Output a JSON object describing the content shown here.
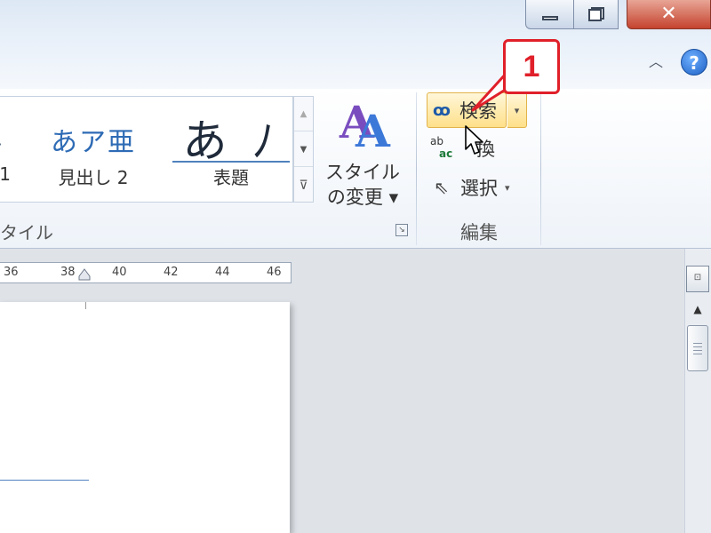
{
  "styles_group": {
    "items": [
      {
        "sample": "亜",
        "label": "1"
      },
      {
        "sample": "あア亜",
        "label": "見出し 2"
      },
      {
        "sample": "あ ﾉ",
        "label": "表題"
      }
    ],
    "change_style_label": "スタイルの変更",
    "group_label": "タイル"
  },
  "edit_group": {
    "find_label": "検索",
    "replace_label": "換",
    "replace_icon_top": "ab",
    "replace_icon_bottom": "ac",
    "select_label": "選択",
    "group_label": "編集"
  },
  "callout": {
    "number": "1"
  },
  "ruler": {
    "ticks": [
      "36",
      "38",
      "40",
      "42",
      "44",
      "46"
    ]
  },
  "help_label": "?",
  "colors": {
    "accent": "#e0202a",
    "find_highlight": "#ffe08a",
    "heading_blue": "#2e6bb5"
  },
  "icons": [
    "minimize-icon",
    "restore-icon",
    "close-icon",
    "collapse-ribbon-icon",
    "help-icon",
    "change-styles-icon",
    "launcher-icon",
    "binoculars-icon",
    "replace-icon",
    "select-arrow-icon",
    "mouse-cursor-icon",
    "scroll-up-icon"
  ]
}
